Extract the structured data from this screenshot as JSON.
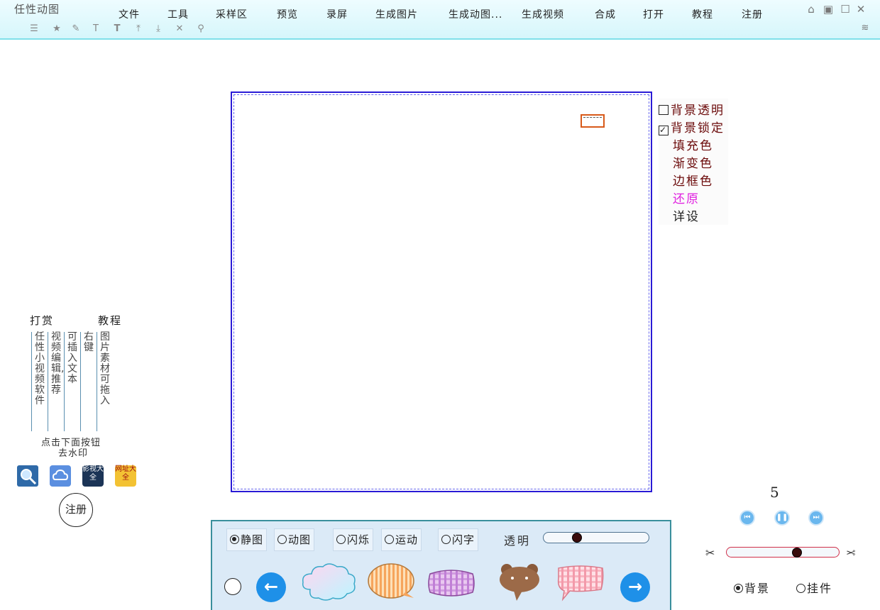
{
  "app_title": "任性动图",
  "menu": [
    "文件",
    "工具",
    "采样区",
    "预览",
    "录屏",
    "生成图片",
    "生成动图...",
    "生成视频",
    "合成",
    "打开",
    "教程",
    "注册"
  ],
  "toolbar_icons": [
    "align-icon",
    "star-icon",
    "pen-icon",
    "text-rotate-icon",
    "text-icon",
    "align-top-icon",
    "align-bottom-icon",
    "close-icon",
    "pin-icon"
  ],
  "right_panel": {
    "bg_transparent": "背景透明",
    "bg_lock": "背景锁定",
    "fill_color": "填充色",
    "gradient_color": "渐变色",
    "border_color": "边框色",
    "restore": "还原",
    "details": "详设",
    "bg_transparent_checked": false,
    "bg_lock_checked": true,
    "restore_color": "#e020e0",
    "label_color": "#6b0a0a"
  },
  "left_panel": {
    "reward": "打赏",
    "tutorial": "教程",
    "col1": "任性小视频软件",
    "col2": "视频编辑,推荐",
    "col3": "可插入文本",
    "col4": "右键",
    "col5": "图片素材 可拖入",
    "note_line1": "点击下面按钮",
    "note_line2": "去水印",
    "register": "注册",
    "icon_badge_1": "影视大全",
    "icon_badge_2": "网址大全"
  },
  "bottom_panel": {
    "static_image": "静图",
    "animated_image": "动图",
    "flash": "闪烁",
    "motion": "运动",
    "flash_text": "闪字",
    "transparency": "透明",
    "transparency_level": 0.3,
    "selected_mode": "静图"
  },
  "right_bottom": {
    "frame_number": "5",
    "trim_level": 0.64,
    "background": "背景",
    "widget": "挂件",
    "selected_layer": "背景"
  },
  "colors": {
    "canvas_border": "#2a1bd6",
    "accent_blue": "#1e90e8",
    "topbar_bg": "#d6f6fb"
  }
}
